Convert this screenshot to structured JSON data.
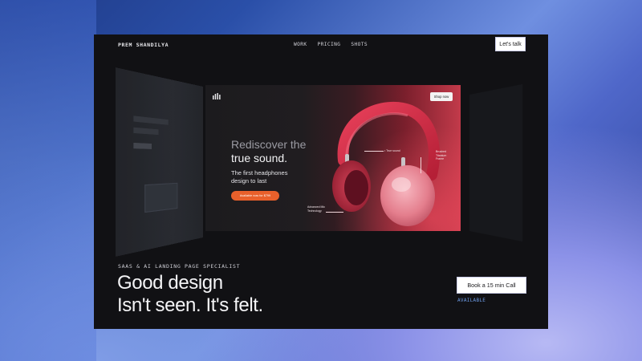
{
  "nav": {
    "brand": "PREM SHANDILYA",
    "links": [
      "WORK",
      "PRICING",
      "SHOTS"
    ],
    "cta": "Let's talk"
  },
  "hero_card": {
    "shop_button": "Shop now",
    "headline_line1": "Rediscover the",
    "headline_line2": "true sound.",
    "subtitle": "The first headphones design to last",
    "pill": "Available now for $799",
    "callouts": {
      "true_sound": "• True sound",
      "frame": "Brushed Titanium Frame",
      "mic": "Advanced Mic Technology"
    }
  },
  "eyebrow": "SAAS & AI LANDING PAGE SPECIALIST",
  "headline": {
    "line1": "Good design",
    "line2": "Isn't seen. It's felt."
  },
  "book_button": "Book a 15 min Call",
  "status": "AVAILABLE",
  "colors": {
    "site_bg": "#111114",
    "accent_orange": "#e8602b",
    "available_blue": "#6d9be6",
    "headphone_red": "#d8324a"
  }
}
